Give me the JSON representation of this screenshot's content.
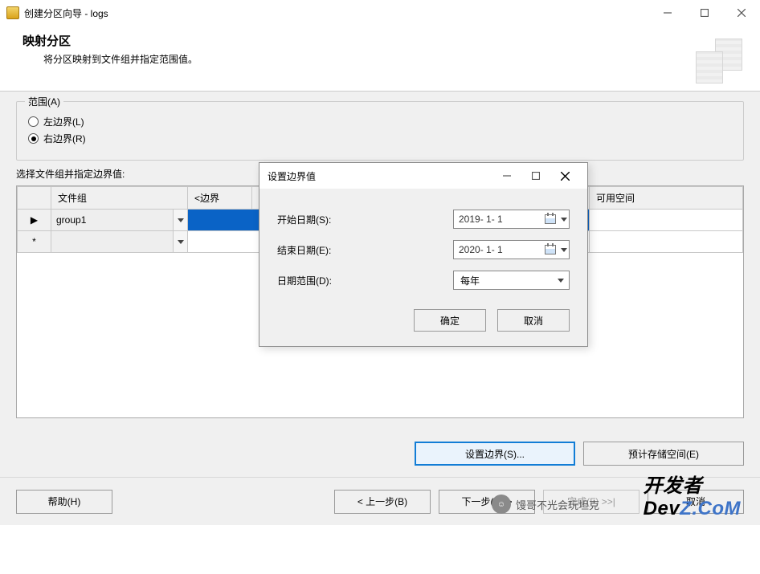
{
  "window": {
    "title": "创建分区向导 - logs"
  },
  "header": {
    "heading": "映射分区",
    "subheading": "将分区映射到文件组并指定范围值。"
  },
  "range_group": {
    "legend": "范围(A)",
    "opt_left_label": "左边界(L)",
    "opt_right_label": "右边界(R)"
  },
  "select_label": "选择文件组并指定边界值:",
  "table": {
    "col_filegroup": "文件组",
    "col_boundary": "<边界",
    "col_space": "可用空间",
    "rows": [
      {
        "marker": "▶",
        "filegroup": "group1"
      },
      {
        "marker": "*",
        "filegroup": ""
      }
    ]
  },
  "lower_buttons": {
    "set_boundary": "设置边界(S)...",
    "estimate": "预计存储空间(E)"
  },
  "nav": {
    "help": "帮助(H)",
    "back": "< 上一步(B)",
    "next": "下一步(N) >",
    "finish": "完成(F) >>|",
    "cancel": "取消"
  },
  "modal": {
    "title": "设置边界值",
    "start_label": "开始日期(S):",
    "start_value": "2019- 1- 1",
    "end_label": "结束日期(E):",
    "end_value": "2020- 1- 1",
    "range_label": "日期范围(D):",
    "range_value": "每年",
    "ok": "确定",
    "cancel": "取消"
  },
  "watermark": {
    "author": "馒哥不光会玩坦克",
    "brand1": "开发者",
    "brand2_a": "Dev",
    "brand2_b": "Z.CoM"
  }
}
